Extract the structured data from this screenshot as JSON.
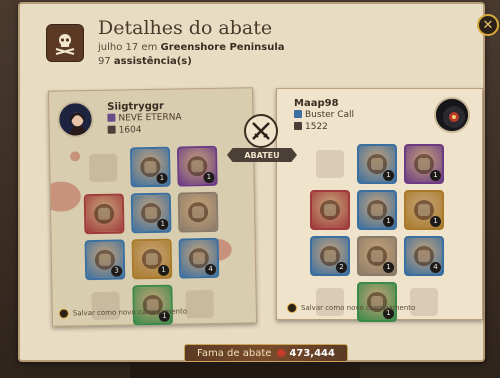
{
  "window": {
    "title": "Detalhes do abate",
    "date_text": "julho 17 em",
    "location": "Greenshore Peninsula",
    "assist_count": "97",
    "assist_label": "assistência(s)",
    "close_label": "✕"
  },
  "killer": {
    "name": "Siigtryggr",
    "guild": "NEVE ETERNA",
    "item_power": "1604",
    "save_text": "Salvar como novo carregamento",
    "slots": [
      {
        "type": "empty"
      },
      {
        "type": "item",
        "icon": "hood-icon",
        "color": "#3b6fa0",
        "qty": "1"
      },
      {
        "type": "item",
        "icon": "cape-icon",
        "color": "#6b3b84",
        "qty": "1"
      },
      {
        "type": "item",
        "icon": "bow-icon",
        "color": "#a03b3b",
        "qty": ""
      },
      {
        "type": "item",
        "icon": "armor-icon",
        "color": "#3b6fa0",
        "qty": "1"
      },
      {
        "type": "item",
        "icon": "crossbow-ghost-icon",
        "color": "#8a7a68",
        "qty": ""
      },
      {
        "type": "item",
        "icon": "potion-icon",
        "color": "#3b6fa0",
        "qty": "3"
      },
      {
        "type": "item",
        "icon": "boots-icon",
        "color": "#a87a2a",
        "qty": "1"
      },
      {
        "type": "item",
        "icon": "food-icon",
        "color": "#3b6fa0",
        "qty": "4"
      },
      {
        "type": "empty"
      },
      {
        "type": "item",
        "icon": "mount-icon",
        "color": "#3b8a4a",
        "qty": "1"
      },
      {
        "type": "empty"
      }
    ]
  },
  "victim": {
    "name": "Maap98",
    "guild": "Buster Call",
    "item_power": "1522",
    "save_text": "Salvar como novo carregamento",
    "slots": [
      {
        "type": "empty"
      },
      {
        "type": "item",
        "icon": "helmet-icon",
        "color": "#3b6fa0",
        "qty": "1"
      },
      {
        "type": "item",
        "icon": "cape-icon",
        "color": "#6b3b84",
        "qty": "1"
      },
      {
        "type": "item",
        "icon": "sword-icon",
        "color": "#a03b3b",
        "qty": ""
      },
      {
        "type": "item",
        "icon": "plate-armor-icon",
        "color": "#3b6fa0",
        "qty": "1"
      },
      {
        "type": "item",
        "icon": "shield-icon",
        "color": "#a87a2a",
        "qty": "1"
      },
      {
        "type": "item",
        "icon": "potion-icon",
        "color": "#3b6fa0",
        "qty": "2"
      },
      {
        "type": "item",
        "icon": "boots-icon",
        "color": "#8a7a68",
        "qty": "1"
      },
      {
        "type": "item",
        "icon": "food-icon",
        "color": "#3b6fa0",
        "qty": "4"
      },
      {
        "type": "empty"
      },
      {
        "type": "item",
        "icon": "mount-icon",
        "color": "#3b8a4a",
        "qty": "1"
      },
      {
        "type": "empty"
      }
    ]
  },
  "versus": {
    "label": "ABATEU"
  },
  "fame": {
    "label": "Fama de abate",
    "value": "473,444"
  }
}
